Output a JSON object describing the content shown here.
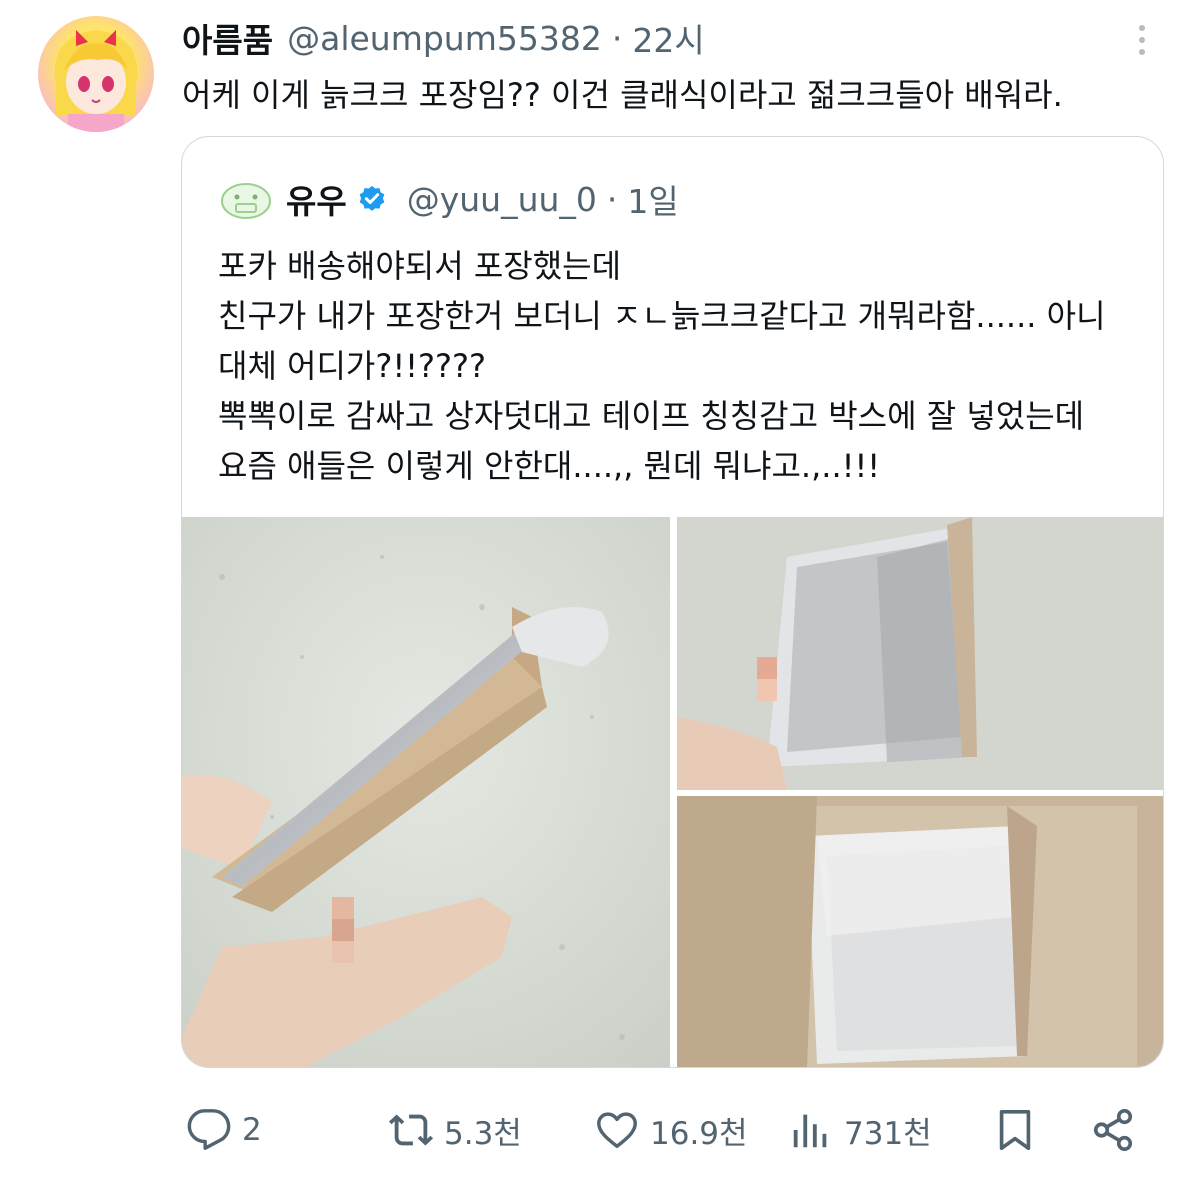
{
  "tweet": {
    "display_name": "아름품",
    "handle": "@aleumpum55382",
    "separator": "·",
    "time": "22시",
    "text": "어케 이게 늙크크 포장임?? 이건 클래식이라고 젊크크들아 배워라."
  },
  "quoted": {
    "display_name": "유우",
    "handle": "@yuu_uu_0",
    "separator": "·",
    "time": "1일",
    "lines": [
      "포카 배송해야되서 포장했는데",
      "친구가 내가 포장한거 보더니 ㅈㄴ늙크크같다고 개뭐라함...... 아니",
      "대체 어디가?!!????",
      "뽁뽁이로 감싸고 상자덧대고 테이프 칭칭감고 박스에 잘 넣었는데",
      "요즘 애들은 이렇게 안한대....,, 뭔데 뭐냐고.,..!!!"
    ],
    "verified_color": "#1d9bf0"
  },
  "actions": {
    "replies": "2",
    "retweets": "5.3천",
    "likes": "16.9천",
    "views": "731천"
  },
  "icons": [
    "more-icon",
    "reply-icon",
    "retweet-icon",
    "like-icon",
    "views-icon",
    "bookmark-icon",
    "share-icon",
    "verified-icon"
  ]
}
